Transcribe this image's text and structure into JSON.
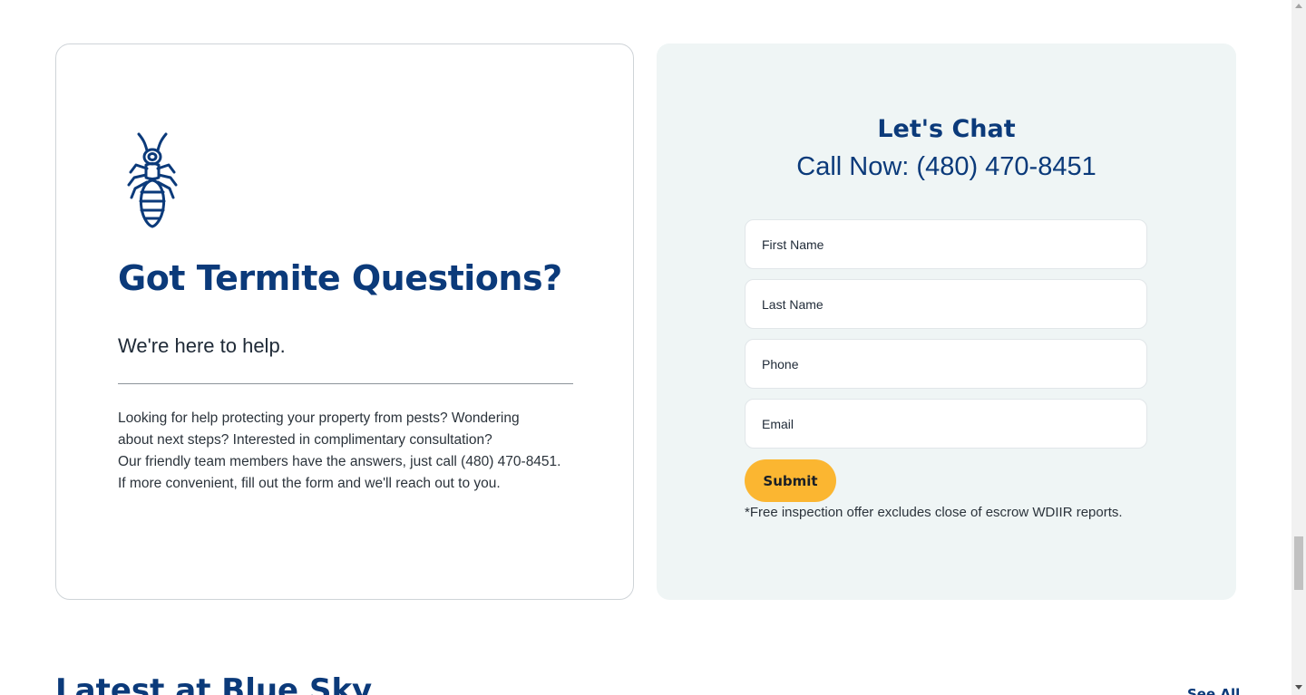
{
  "left_card": {
    "icon": "termite-icon",
    "title": "Got Termite Questions?",
    "subtitle": "We're here to help.",
    "body_lines": [
      "Looking for help protecting your property from pests? Wondering",
      "about next steps? Interested in complimentary consultation?",
      "Our friendly team members have the answers, just call (480) 470-8451.",
      "If more convenient, fill out the form and we'll reach out to you."
    ]
  },
  "right_card": {
    "title": "Let's Chat",
    "phone_text": "Call Now: (480) 470-8451",
    "fields": {
      "first_name": {
        "placeholder": "First Name",
        "value": ""
      },
      "last_name": {
        "placeholder": "Last Name",
        "value": ""
      },
      "phone": {
        "placeholder": "Phone",
        "value": ""
      },
      "email": {
        "placeholder": "Email",
        "value": ""
      }
    },
    "submit_label": "Submit",
    "disclaimer": "*Free inspection offer excludes close of escrow WDIIR reports."
  },
  "latest": {
    "title": "Latest at Blue Sky",
    "see_all": "See All"
  },
  "colors": {
    "brand_navy": "#0b3a7a",
    "accent_yellow": "#fbb631",
    "panel_bg": "#eff5f5"
  },
  "scrollbar": {
    "position_fraction": 0.77
  }
}
